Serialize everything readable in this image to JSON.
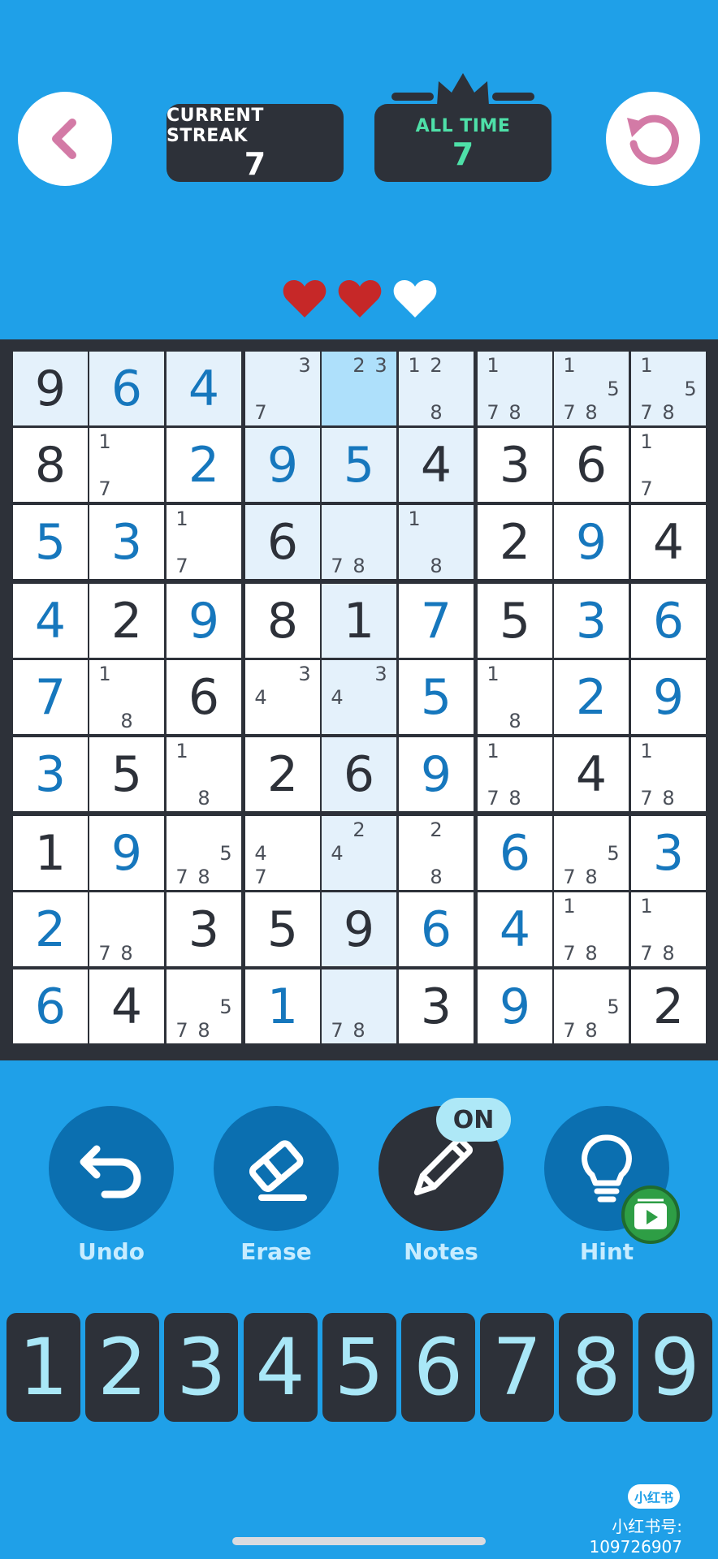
{
  "header": {
    "back_icon": "chevron-left-icon",
    "restart_icon": "restart-icon",
    "current_streak": {
      "label": "CURRENT STREAK",
      "value": "7"
    },
    "all_time": {
      "label": "ALL TIME",
      "value": "7"
    }
  },
  "lives": {
    "total": 3,
    "remaining": 2,
    "colors": {
      "full": "#c62828",
      "empty": "#ffffff"
    }
  },
  "colors": {
    "background": "#1fa0e8",
    "dark": "#2d3139",
    "user_digit": "#1677bd",
    "highlight": "#e4f1fb",
    "selected": "#aee0fb"
  },
  "board": {
    "selected_cell": [
      0,
      4
    ],
    "rows": [
      [
        "9",
        "6",
        "4",
        "",
        "",
        "",
        "",
        "",
        ""
      ],
      [
        "8",
        "",
        "2",
        "9",
        "5",
        "4",
        "3",
        "6",
        ""
      ],
      [
        "5",
        "3",
        "",
        "6",
        "",
        "",
        "2",
        "9",
        "4"
      ],
      [
        "4",
        "2",
        "9",
        "8",
        "1",
        "7",
        "5",
        "3",
        "6"
      ],
      [
        "7",
        "",
        "6",
        "",
        "",
        "5",
        "",
        "2",
        "9"
      ],
      [
        "3",
        "5",
        "",
        "2",
        "6",
        "9",
        "",
        "4",
        ""
      ],
      [
        "1",
        "9",
        "",
        "",
        "",
        "",
        "6",
        "",
        "3"
      ],
      [
        "2",
        "",
        "3",
        "5",
        "9",
        "6",
        "4",
        "",
        ""
      ],
      [
        "6",
        "4",
        "",
        "1",
        "",
        "3",
        "9",
        "",
        "2"
      ]
    ],
    "user_entered": [
      [
        false,
        true,
        true,
        false,
        false,
        false,
        false,
        false,
        false
      ],
      [
        false,
        false,
        true,
        true,
        true,
        false,
        false,
        false,
        false
      ],
      [
        true,
        true,
        false,
        false,
        false,
        false,
        false,
        true,
        false
      ],
      [
        true,
        false,
        true,
        false,
        false,
        true,
        false,
        true,
        true
      ],
      [
        true,
        false,
        false,
        false,
        false,
        true,
        false,
        true,
        true
      ],
      [
        true,
        false,
        false,
        false,
        false,
        true,
        false,
        false,
        false
      ],
      [
        false,
        true,
        false,
        false,
        false,
        false,
        true,
        false,
        true
      ],
      [
        true,
        false,
        false,
        false,
        false,
        true,
        true,
        false,
        false
      ],
      [
        true,
        false,
        false,
        true,
        false,
        false,
        true,
        false,
        false
      ]
    ],
    "notes": [
      [
        [],
        [],
        [],
        [
          3,
          7
        ],
        [
          2,
          3
        ],
        [
          1,
          2,
          8
        ],
        [
          1,
          7,
          8
        ],
        [
          1,
          5,
          7,
          8
        ],
        [
          1,
          5,
          7,
          8
        ]
      ],
      [
        [],
        [
          1,
          7
        ],
        [],
        [],
        [],
        [],
        [],
        [],
        [
          1,
          7
        ]
      ],
      [
        [],
        [],
        [
          1,
          7
        ],
        [],
        [
          7,
          8
        ],
        [
          1,
          8
        ],
        [],
        [],
        []
      ],
      [
        [],
        [],
        [],
        [],
        [],
        [],
        [],
        [],
        []
      ],
      [
        [],
        [
          1,
          8
        ],
        [],
        [
          3,
          4
        ],
        [
          3,
          4
        ],
        [],
        [
          1,
          8
        ],
        [],
        []
      ],
      [
        [],
        [],
        [
          1,
          8
        ],
        [],
        [],
        [],
        [
          1,
          7,
          8
        ],
        [],
        [
          1,
          7,
          8
        ]
      ],
      [
        [],
        [],
        [
          5,
          7,
          8
        ],
        [
          4,
          7
        ],
        [
          2,
          4
        ],
        [
          2,
          8
        ],
        [],
        [
          5,
          7,
          8
        ],
        []
      ],
      [
        [],
        [
          7,
          8
        ],
        [],
        [],
        [],
        [],
        [],
        [
          1,
          7,
          8
        ],
        [
          1,
          7,
          8
        ]
      ],
      [
        [],
        [],
        [
          5,
          7,
          8
        ],
        [],
        [
          7,
          8
        ],
        [],
        [],
        [
          5,
          7,
          8
        ],
        []
      ]
    ]
  },
  "tools": [
    {
      "label": "Undo",
      "icon": "undo-icon"
    },
    {
      "label": "Erase",
      "icon": "eraser-icon"
    },
    {
      "label": "Notes",
      "icon": "pencil-icon",
      "badge": "ON"
    },
    {
      "label": "Hint",
      "icon": "lightbulb-icon"
    }
  ],
  "numpad": [
    "1",
    "2",
    "3",
    "4",
    "5",
    "6",
    "7",
    "8",
    "9"
  ],
  "watermark": {
    "badge": "小红书",
    "text": "小红书号: 109726907"
  }
}
